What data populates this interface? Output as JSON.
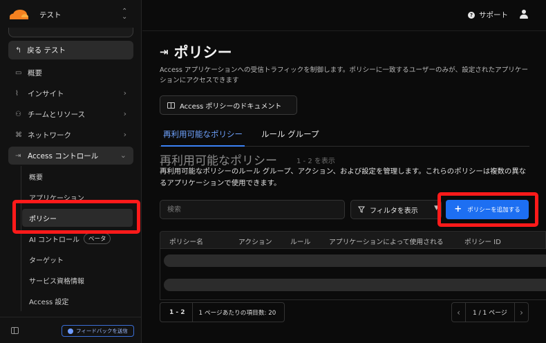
{
  "account": {
    "name": "テスト"
  },
  "sidebar": {
    "back_label": "戻る テスト",
    "items": [
      {
        "label": "概要",
        "icon": "window-icon"
      },
      {
        "label": "インサイト",
        "icon": "chart-icon"
      },
      {
        "label": "チームとリソース",
        "icon": "team-icon"
      },
      {
        "label": "ネットワーク",
        "icon": "network-icon"
      },
      {
        "label": "Access コントロール",
        "icon": "access-icon"
      }
    ],
    "access_sub": [
      {
        "label": "概要"
      },
      {
        "label": "アプリケーション"
      },
      {
        "label": "ポリシー"
      },
      {
        "label": "AI コントロール",
        "badge": "ベータ"
      },
      {
        "label": "ターゲット"
      },
      {
        "label": "サービス資格情報"
      },
      {
        "label": "Access 設定"
      }
    ],
    "feedback_label": "フィードバックを送信"
  },
  "topbar": {
    "support_label": "サポート"
  },
  "page": {
    "title": "ポリシー",
    "description": "Access アプリケーションへの受信トラフィックを制御します。ポリシーに一致するユーザーのみが、設定されたアプリケーションにアクセスできます",
    "doc_button": "Access ポリシーのドキュメント",
    "tabs": [
      {
        "label": "再利用可能なポリシー"
      },
      {
        "label": "ルール グループ"
      }
    ],
    "section_title": "再利用可能なポリシー",
    "section_count": "1 - 2 を表示",
    "section_description": "再利用可能なポリシーのルール グループ、アクション、および設定を管理します。これらのポリシーは複数の異なるアプリケーションで使用できます。",
    "search_placeholder": "検索",
    "filter_label": "フィルタを表示",
    "add_button": "ポリシーを追加する",
    "table_columns": [
      "ポリシー名",
      "アクション",
      "ルール",
      "アプリケーションによって使用される",
      "ポリシー ID"
    ],
    "pagination": {
      "range": "1 - 2",
      "per_page": "1 ページあたりの項目数: 20",
      "page_label": "1 / 1 ページ"
    }
  },
  "colors": {
    "accent": "#1d6ff2",
    "highlight": "#ff1a1a",
    "background": "#0b0b0b"
  }
}
